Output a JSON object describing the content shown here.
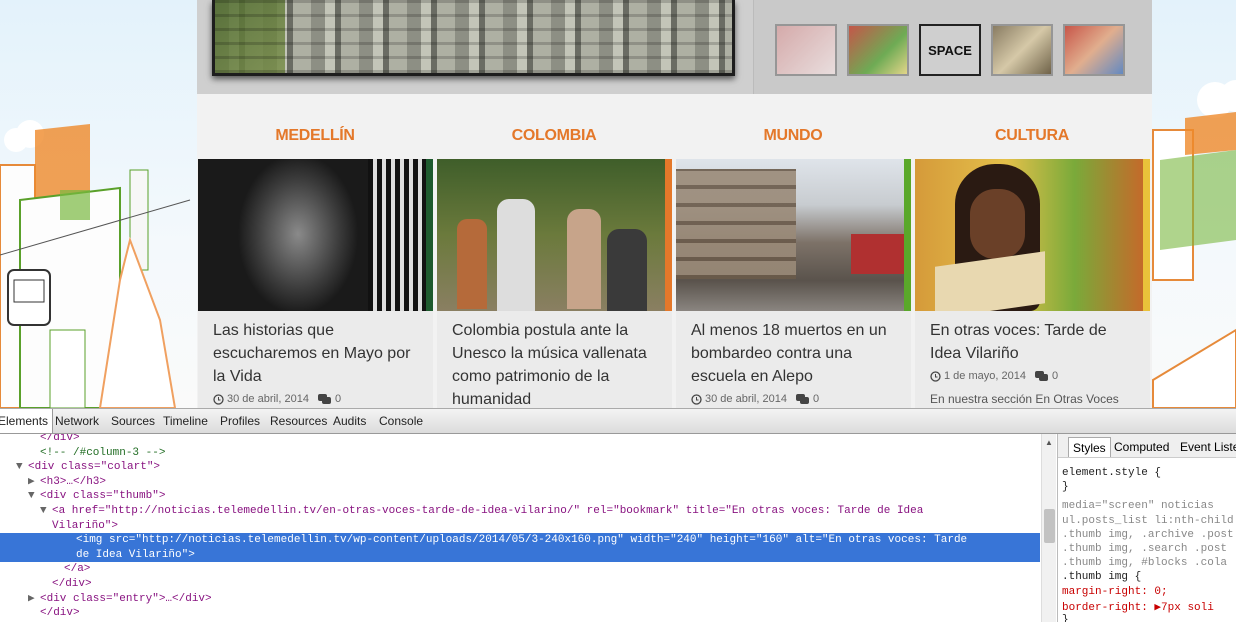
{
  "categories": [
    "MEDELLÍN",
    "COLOMBIA",
    "MUNDO",
    "CULTURA"
  ],
  "articles": [
    {
      "title": "Las historias que escucharemos en Mayo por la Vida",
      "date": "30 de abril, 2014",
      "comments": "0",
      "accent": "#1e5a2e"
    },
    {
      "title": "Colombia postula ante la Unesco la música vallenata como patrimonio de la humanidad",
      "date": "",
      "comments": "",
      "accent": "#e4782a"
    },
    {
      "title": "Al menos 18 muertos en un bombardeo contra una escuela en Alepo",
      "date": "30 de abril, 2014",
      "comments": "0",
      "accent": "#5aa82a"
    },
    {
      "title": "En otras voces: Tarde de Idea Vilariño",
      "date": "1 de mayo, 2014",
      "comments": "0",
      "excerpt": "En nuestra sección En Otras Voces",
      "accent": "#e9c23a"
    }
  ],
  "slider": {
    "thumb_active_text": "SPACE"
  },
  "devtools": {
    "tabs": [
      "Elements",
      "Network",
      "Sources",
      "Timeline",
      "Profiles",
      "Resources",
      "Audits",
      "Console"
    ],
    "dom_lines": [
      {
        "arrow": "",
        "indent": 40,
        "text": "</div>",
        "cls": "tag"
      },
      {
        "arrow": "",
        "indent": 40,
        "text": "<!-- /#column-3 -->",
        "cls": "com"
      },
      {
        "arrow": "▼",
        "indent": 28,
        "text": "<div class=\"colart\">",
        "cls": "tag"
      },
      {
        "arrow": "▶",
        "indent": 40,
        "text": "<h3>…</h3>",
        "cls": "tag"
      },
      {
        "arrow": "▼",
        "indent": 40,
        "text": "<div class=\"thumb\">",
        "cls": "tag"
      },
      {
        "arrow": "▼",
        "indent": 52,
        "text": "<a href=\"http://noticias.telemedellin.tv/en-otras-voces-tarde-de-idea-vilarino/\" rel=\"bookmark\" title=\"En otras voces: Tarde de Idea",
        "cls": "tag"
      },
      {
        "arrow": "",
        "indent": 52,
        "text": "Vilariño\">",
        "cls": "tag"
      },
      {
        "arrow": "",
        "indent": 76,
        "text": "<img src=\"http://noticias.telemedellin.tv/wp-content/uploads/2014/05/3-240x160.png\" width=\"240\" height=\"160\" alt=\"En otras voces: Tarde",
        "cls": "tag",
        "selected": true
      },
      {
        "arrow": "",
        "indent": 76,
        "text": "de Idea Vilariño\">",
        "cls": "tag",
        "selected": true
      },
      {
        "arrow": "",
        "indent": 64,
        "text": "</a>",
        "cls": "tag"
      },
      {
        "arrow": "",
        "indent": 52,
        "text": "</div>",
        "cls": "tag"
      },
      {
        "arrow": "▶",
        "indent": 40,
        "text": "<div class=\"entry\">…</div>",
        "cls": "tag"
      },
      {
        "arrow": "",
        "indent": 40,
        "text": "</div>",
        "cls": "tag"
      }
    ],
    "styles_tabs": [
      "Styles",
      "Computed",
      "Event Listeners"
    ],
    "styles_lines": [
      {
        "text": "element.style {",
        "dim": false
      },
      {
        "text": "}",
        "dim": false
      },
      {
        "text": "media=\"screen\"        noticias",
        "dim": true
      },
      {
        "text": "ul.posts_list li:nth-child",
        "dim": true
      },
      {
        "text": ".thumb img, .archive .post",
        "dim": true
      },
      {
        "text": ".thumb img, .search .post",
        "dim": true
      },
      {
        "text": ".thumb img, #blocks .cola",
        "dim": true
      },
      {
        "text": ".thumb img {",
        "dim": false
      },
      {
        "text": "  margin-right: 0;",
        "dim": false,
        "prop": true
      },
      {
        "text": "  border-right: ▶7px soli",
        "dim": false,
        "prop": true
      },
      {
        "text": "}",
        "dim": false
      }
    ]
  }
}
